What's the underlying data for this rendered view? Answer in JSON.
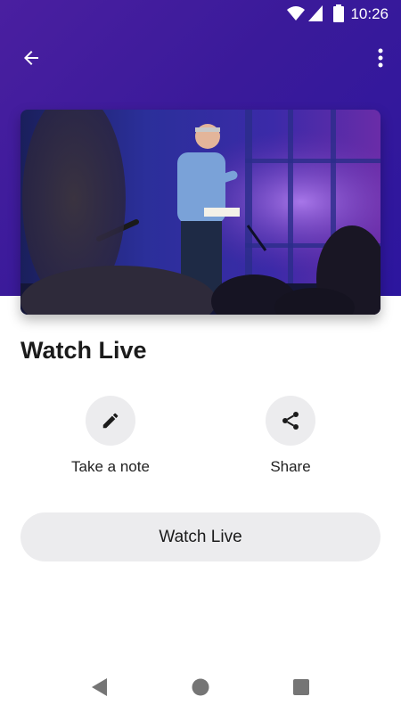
{
  "status_bar": {
    "time": "10:26",
    "icons": [
      "wifi-icon",
      "cellular-signal-icon",
      "battery-icon"
    ]
  },
  "app_bar": {
    "back_icon": "arrow-back-icon",
    "menu_icon": "more-vertical-icon"
  },
  "hero": {
    "image": "preacher-on-stage-photo"
  },
  "page": {
    "title": "Watch Live"
  },
  "actions": [
    {
      "label": "Take a note",
      "icon": "pencil-icon"
    },
    {
      "label": "Share",
      "icon": "share-icon"
    }
  ],
  "watch_button": {
    "label": "Watch Live"
  },
  "nav_bar": {
    "icons": [
      "nav-back-icon",
      "nav-home-icon",
      "nav-recents-icon"
    ]
  },
  "colors": {
    "header": "#3a1a9a",
    "button_bg": "#ececee",
    "text": "#1b1b1b"
  }
}
